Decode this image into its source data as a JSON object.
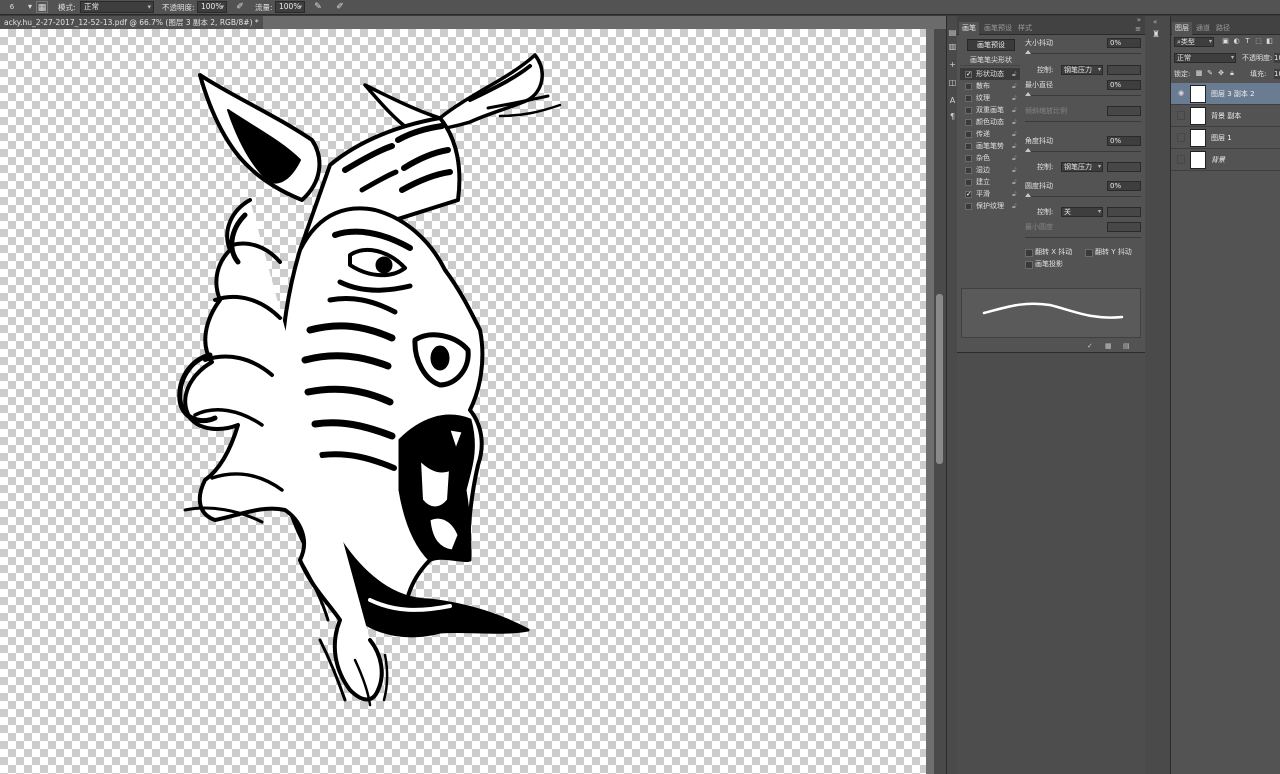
{
  "options_bar": {
    "tool_badge": "6",
    "mode_label": "模式:",
    "mode_value": "正常",
    "opacity_label": "不透明度:",
    "opacity_value": "100%",
    "flow_label": "流量:",
    "flow_value": "100%"
  },
  "document": {
    "tab_title": "acky.hu_2-27-2017_12-52-13.pdf @ 66.7% (图层 3 副本 2, RGB/8#) *"
  },
  "brush_panel": {
    "tabs": [
      {
        "label": "画笔",
        "active": true
      },
      {
        "label": "画笔预设",
        "active": false
      },
      {
        "label": "样式",
        "active": false
      }
    ],
    "preset_button": "画笔预设",
    "tip_shape_label": "画笔笔尖形状",
    "options": [
      {
        "label": "形状动态",
        "checked": true,
        "active": true
      },
      {
        "label": "散布",
        "checked": false,
        "active": false
      },
      {
        "label": "纹理",
        "checked": false,
        "active": false
      },
      {
        "label": "双重画笔",
        "checked": false,
        "active": false
      },
      {
        "label": "颜色动态",
        "checked": false,
        "active": false
      },
      {
        "label": "传递",
        "checked": false,
        "active": false
      },
      {
        "label": "画笔笔势",
        "checked": false,
        "active": false
      },
      {
        "label": "杂色",
        "checked": false,
        "active": false
      },
      {
        "label": "湿边",
        "checked": false,
        "active": false
      },
      {
        "label": "建立",
        "checked": false,
        "active": false
      },
      {
        "label": "平滑",
        "checked": true,
        "active": false
      },
      {
        "label": "保护纹理",
        "checked": false,
        "active": false
      }
    ],
    "size_jitter_label": "大小抖动",
    "size_jitter_value": "0%",
    "control_label": "控制:",
    "size_control_value": "钢笔压力",
    "min_diameter_label": "最小直径",
    "min_diameter_value": "0%",
    "tilt_scale_label": "倾斜缩放比例",
    "angle_jitter_label": "角度抖动",
    "angle_jitter_value": "0%",
    "angle_control_value": "钢笔压力",
    "roundness_jitter_label": "圆度抖动",
    "roundness_jitter_value": "0%",
    "roundness_control_value": "关",
    "min_roundness_label": "最小圆度",
    "flip_x_label": "翻转 X 抖动",
    "flip_y_label": "翻转 Y 抖动",
    "brush_projection_label": "画笔投影"
  },
  "layers_panel": {
    "tabs": [
      {
        "label": "图层",
        "active": true
      },
      {
        "label": "通道",
        "active": false
      },
      {
        "label": "路径",
        "active": false
      }
    ],
    "filter_value": "类型",
    "blend_mode": "正常",
    "opacity_label": "不透明度:",
    "opacity_value": "10",
    "lock_label": "锁定:",
    "fill_label": "填充:",
    "fill_value": "10",
    "layers": [
      {
        "name": "图层 3 副本 2",
        "visible": true,
        "selected": true,
        "italic": false
      },
      {
        "name": "背景 副本",
        "visible": false,
        "selected": false,
        "italic": false
      },
      {
        "name": "图层 1",
        "visible": false,
        "selected": false,
        "italic": false
      },
      {
        "name": "背景",
        "visible": false,
        "selected": false,
        "italic": true
      }
    ]
  },
  "colors": {
    "selected_layer": "#6a7c92",
    "panel_bg": "#535353",
    "canvas_checker": "#cccccc"
  }
}
